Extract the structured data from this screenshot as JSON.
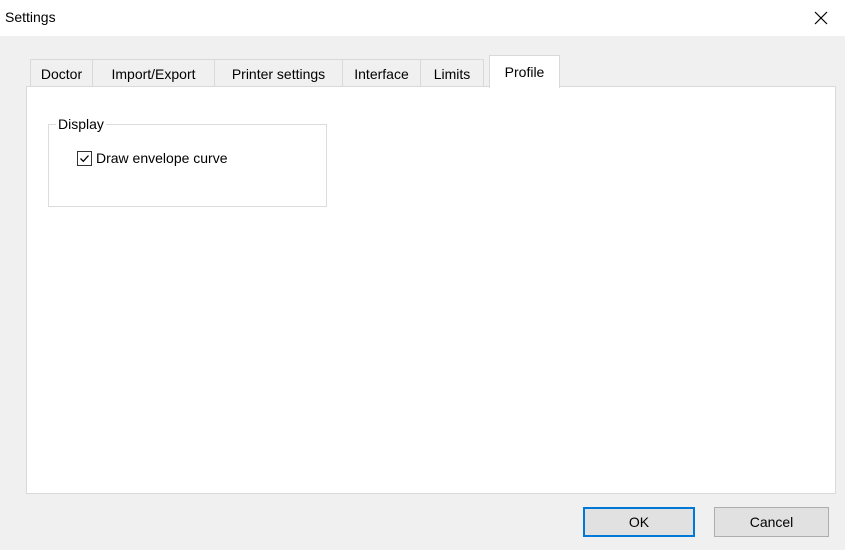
{
  "window": {
    "title": "Settings",
    "close_icon": "close-icon"
  },
  "tabs": [
    {
      "label": "Doctor",
      "active": false
    },
    {
      "label": "Import/Export",
      "active": false
    },
    {
      "label": "Printer settings",
      "active": false
    },
    {
      "label": "Interface",
      "active": false
    },
    {
      "label": "Limits",
      "active": false
    },
    {
      "label": "Profile",
      "active": true
    }
  ],
  "profile": {
    "display_group": {
      "legend": "Display",
      "draw_envelope_curve": {
        "label": "Draw envelope curve",
        "checked": true
      }
    }
  },
  "buttons": {
    "ok_label": "OK",
    "cancel_label": "Cancel"
  },
  "colors": {
    "accent": "#0078d7",
    "client_background": "#f0f0f0",
    "panel_background": "#ffffff"
  }
}
